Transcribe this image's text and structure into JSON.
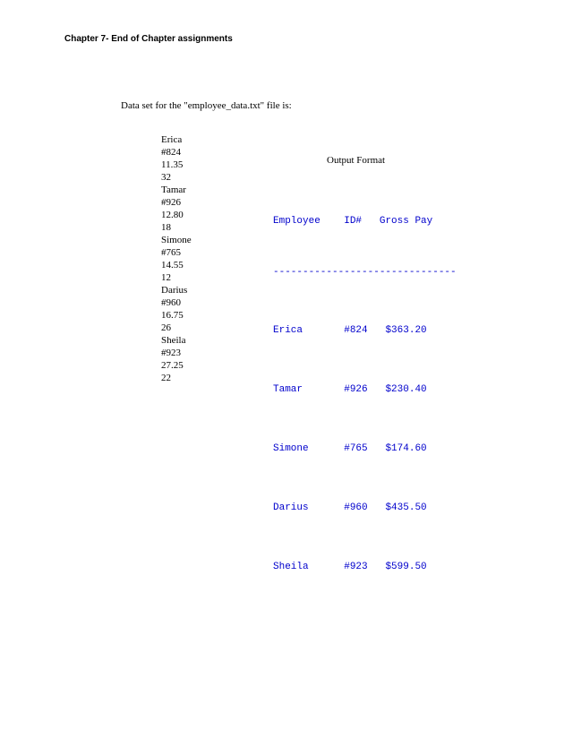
{
  "page": {
    "title": "Chapter 7- End of Chapter assignments",
    "subtitle": "Data set for the \"employee_data.txt\" file is:"
  },
  "dataset": {
    "lines": [
      "Erica",
      "#824",
      "11.35",
      "32",
      "Tamar",
      "#926",
      "12.80",
      "18",
      "Simone",
      "#765",
      "14.55",
      "12",
      "Darius",
      "#960",
      "16.75",
      "26",
      "Sheila",
      "#923",
      "27.25",
      "22"
    ]
  },
  "output": {
    "title": "Output Format",
    "header": {
      "col1": "Employee",
      "col2": "ID#",
      "col3": "Gross Pay"
    },
    "divider": "-------------------------------",
    "rows": [
      {
        "employee": "Erica",
        "id": "#824",
        "pay": "$363.20"
      },
      {
        "employee": "Tamar",
        "id": "#926",
        "pay": "$230.40"
      },
      {
        "employee": "Simone",
        "id": "#765",
        "pay": "$174.60"
      },
      {
        "employee": "Darius",
        "id": "#960",
        "pay": "$435.50"
      },
      {
        "employee": "Sheila",
        "id": "#923",
        "pay": "$599.50"
      }
    ]
  }
}
